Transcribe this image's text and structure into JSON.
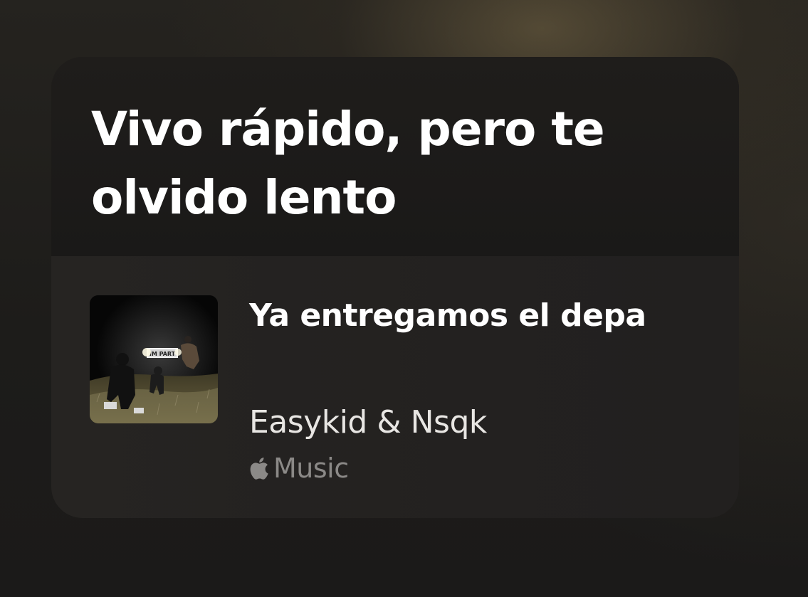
{
  "card": {
    "quote": "Vivo rápido, pero te olvido lento"
  },
  "track": {
    "title": "Ya entregamos el depa",
    "artist": "Easykid & Nsqk",
    "service": "Music",
    "service_icon": "apple-logo-icon",
    "artwork_sign_text": "IM PART"
  },
  "colors": {
    "quote_text": "#ffffff",
    "title_text": "#ffffff",
    "artist_text": "#e8e6e3",
    "service_text": "#8b8987",
    "card_background": "#1c1b1a"
  }
}
